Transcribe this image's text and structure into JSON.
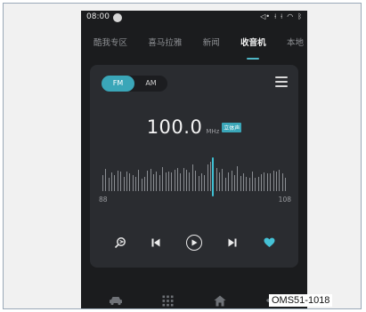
{
  "statusbar": {
    "time": "08:00",
    "icons": [
      "bluetooth-audio-icon",
      "usb-icon",
      "usb-icon-2",
      "wifi-icon",
      "bluetooth-icon"
    ]
  },
  "tabs": [
    {
      "label": "酷我专区",
      "active": false
    },
    {
      "label": "喜马拉雅",
      "active": false
    },
    {
      "label": "新闻",
      "active": false
    },
    {
      "label": "收音机",
      "active": true
    },
    {
      "label": "本地",
      "active": false
    }
  ],
  "band": {
    "fm": "FM",
    "am": "AM",
    "selected": "FM"
  },
  "tuner": {
    "frequency": "100.0",
    "unit": "MHz",
    "stereo_badge": "立体声",
    "scale_min": "88",
    "scale_max": "108",
    "needle_value": 100.0
  },
  "controls": [
    "search-scan-icon",
    "previous-icon",
    "play-icon",
    "next-icon",
    "favorite-heart-icon"
  ],
  "bottom_nav": [
    "car-icon",
    "apps-grid-icon",
    "home-icon",
    "fan-icon"
  ],
  "caption": "OMS51-1018",
  "colors": {
    "accent": "#3aa6b8",
    "background": "#1b1c1e",
    "card": "#2a2c30"
  }
}
